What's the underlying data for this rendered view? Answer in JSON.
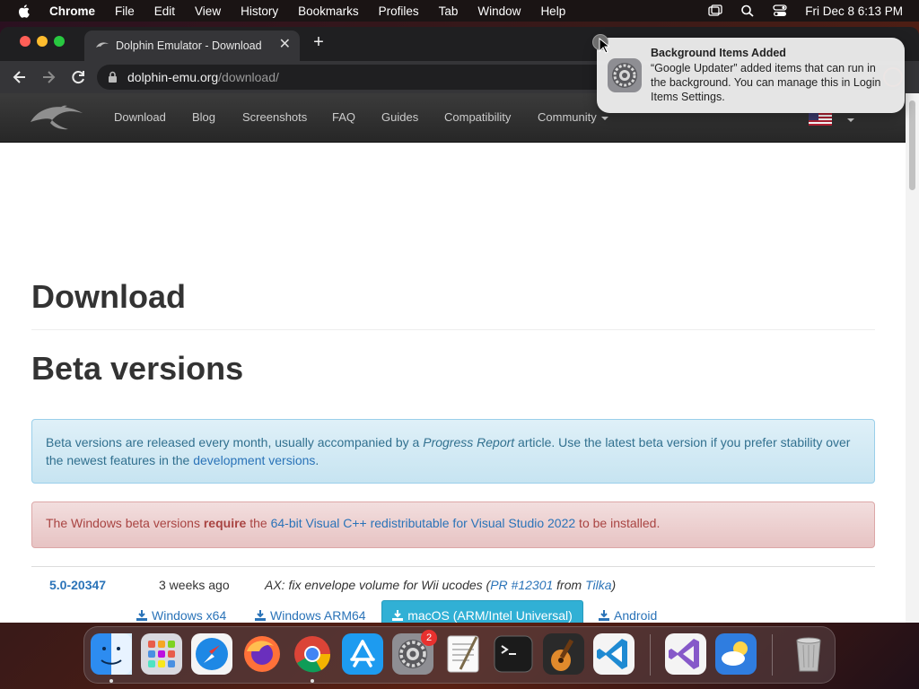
{
  "menubar": {
    "app": "Chrome",
    "items": [
      "File",
      "Edit",
      "View",
      "History",
      "Bookmarks",
      "Profiles",
      "Tab",
      "Window",
      "Help"
    ],
    "clock": "Fri Dec 8  6:13 PM"
  },
  "browser": {
    "tab_title": "Dolphin Emulator - Download",
    "url_host": "dolphin-emu.org",
    "url_path": "/download/"
  },
  "site_nav": {
    "items": [
      "Download",
      "Blog",
      "Screenshots",
      "FAQ",
      "Guides",
      "Compatibility",
      "Community"
    ]
  },
  "page": {
    "h1": "Download",
    "h2": "Beta versions",
    "info": {
      "t1": "Beta versions are released every month, usually accompanied by a ",
      "em": "Progress Report",
      "t2": " article. Use the latest beta version if you prefer stability over the newest features in the ",
      "link": "development versions",
      "t3": "."
    },
    "danger": {
      "t1": "The Windows beta versions ",
      "strong": "require",
      "t2": " the ",
      "link": "64-bit Visual C++ redistributable for Visual Studio 2022",
      "t3": " to be installed."
    },
    "release": {
      "version": "5.0-20347",
      "ago": "3 weeks ago",
      "desc_t1": "AX: fix envelope volume for Wii ucodes (",
      "pr": "PR #12301",
      "desc_t2": " from ",
      "author": "Tilka",
      "desc_t3": ")",
      "downloads": [
        "Windows x64",
        "Windows ARM64",
        "macOS (ARM/Intel Universal)",
        "Android"
      ]
    }
  },
  "notification": {
    "title": "Background Items Added",
    "body": "“Google Updater” added items that can run in the background. You can manage this in Login Items Settings."
  },
  "dock": {
    "apps": [
      "finder-icon",
      "launchpad-icon",
      "safari-icon",
      "firefox-icon",
      "chrome-icon",
      "app-store-icon",
      "system-settings-icon",
      "textedit-icon",
      "terminal-icon",
      "garageband-icon",
      "vscode-icon",
      "visual-studio-icon",
      "weather-icon",
      "trash-icon"
    ],
    "settings_badge": "2"
  }
}
